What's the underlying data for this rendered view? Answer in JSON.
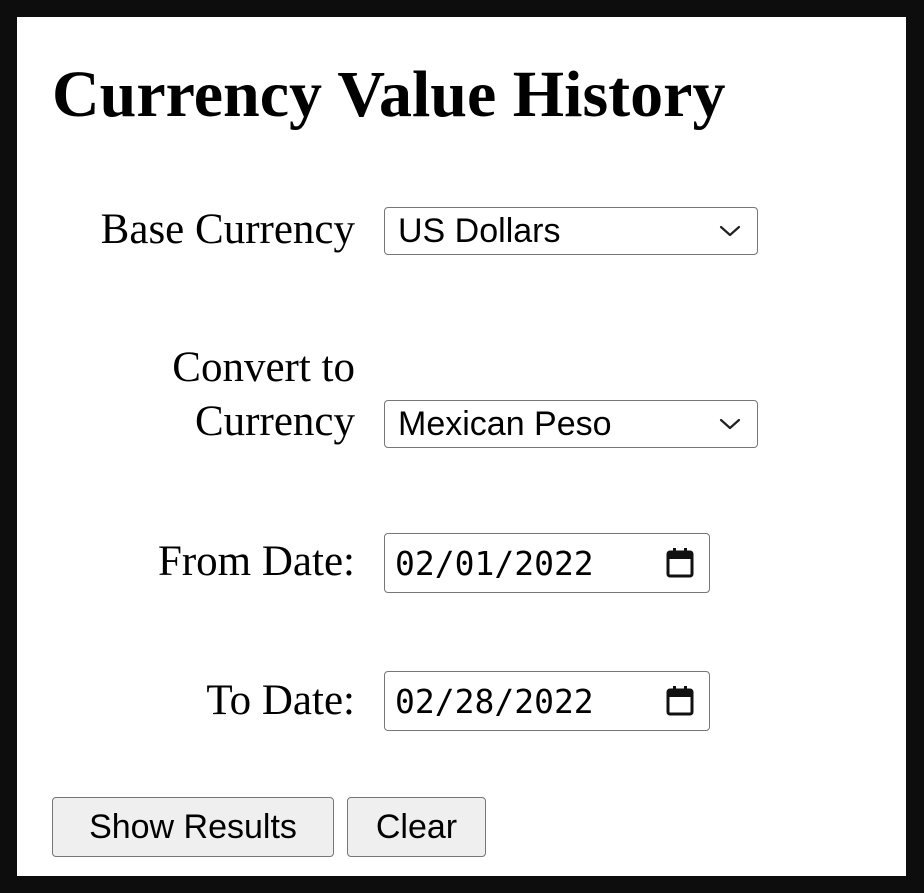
{
  "title": "Currency Value History",
  "form": {
    "base_currency": {
      "label": "Base Currency",
      "value": "US Dollars",
      "icon": "chevron-down-icon"
    },
    "convert_currency": {
      "label_line1": "Convert to",
      "label_line2": "Currency",
      "value": "Mexican Peso",
      "icon": "chevron-down-icon"
    },
    "from_date": {
      "label": "From Date:",
      "value": "02/01/2022",
      "icon": "calendar-icon"
    },
    "to_date": {
      "label": "To Date:",
      "value": "02/28/2022",
      "icon": "calendar-icon"
    }
  },
  "buttons": {
    "show_results": "Show Results",
    "clear": "Clear"
  },
  "colors": {
    "page_border": "#0d0d0d",
    "background": "#ffffff",
    "control_border": "#767676",
    "button_background": "#efefef"
  }
}
